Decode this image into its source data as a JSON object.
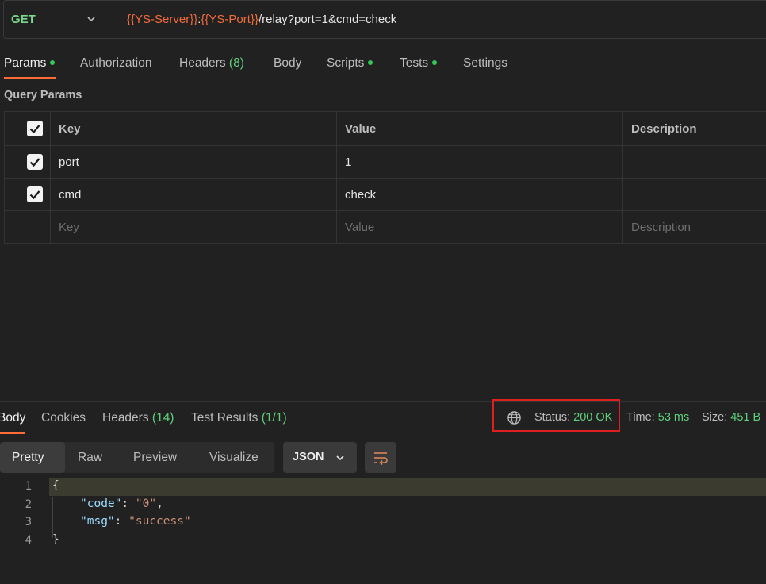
{
  "request": {
    "method": "GET",
    "url_var1": "{{YS-Server}}",
    "url_colon": ":",
    "url_var2": "{{YS-Port}}",
    "url_path": "/relay?port=1&cmd=check"
  },
  "tabs": {
    "params": "Params",
    "authorization": "Authorization",
    "headers": "Headers",
    "headers_count": "(8)",
    "body": "Body",
    "scripts": "Scripts",
    "tests": "Tests",
    "settings": "Settings"
  },
  "query_params": {
    "title": "Query Params",
    "columns": {
      "key": "Key",
      "value": "Value",
      "description": "Description"
    },
    "rows": [
      {
        "key": "port",
        "value": "1",
        "description": ""
      },
      {
        "key": "cmd",
        "value": "check",
        "description": ""
      }
    ],
    "placeholders": {
      "key": "Key",
      "value": "Value",
      "description": "Description"
    }
  },
  "response": {
    "tabs": {
      "body": "Body",
      "cookies": "Cookies",
      "headers": "Headers",
      "headers_count": "(14)",
      "test_results": "Test Results",
      "test_results_count": "(1/1)"
    },
    "status_label": "Status:",
    "status_value": "200 OK",
    "time_label": "Time:",
    "time_value": "53 ms",
    "size_label": "Size:",
    "size_value": "451 B",
    "views": {
      "pretty": "Pretty",
      "raw": "Raw",
      "preview": "Preview",
      "visualize": "Visualize"
    },
    "format": "JSON",
    "code": {
      "line_numbers": [
        "1",
        "2",
        "3",
        "4"
      ],
      "open_brace": "{",
      "close_brace": "}",
      "key1": "\"code\"",
      "val1": "\"0\"",
      "key2": "\"msg\"",
      "val2": "\"success\""
    }
  },
  "colors": {
    "accent": "#ff6c37",
    "success": "#5fcf7a",
    "method_get": "#7bd88f",
    "variable": "#f26b3a",
    "highlight_box": "#e02020"
  }
}
